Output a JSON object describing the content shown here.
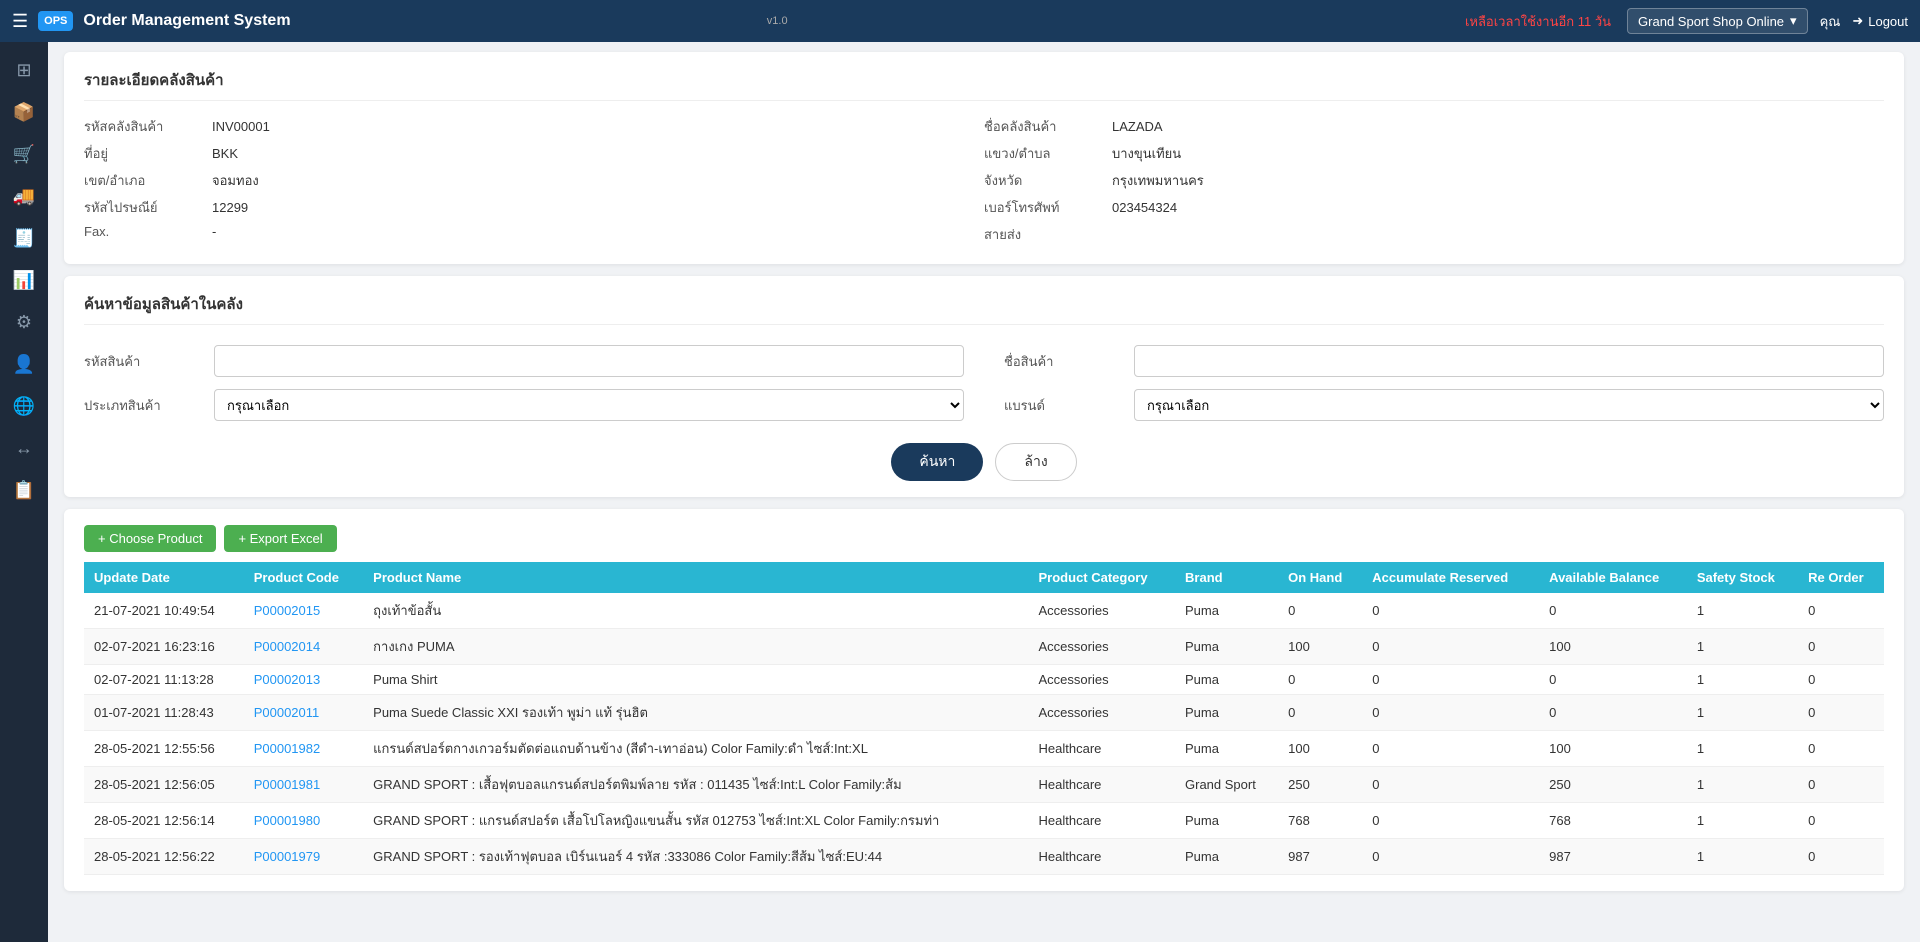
{
  "app": {
    "title": "Order Management System",
    "version": "v1.0",
    "warning": "เหลือเวลาใช้งานอีก 11 วัน",
    "shop_name": "Grand Sport Shop Online",
    "user": "คุณ",
    "logout_label": "Logout"
  },
  "sidebar": {
    "icons": [
      {
        "name": "dashboard-icon",
        "symbol": "⊞"
      },
      {
        "name": "box-icon",
        "symbol": "📦"
      },
      {
        "name": "cart-icon",
        "symbol": "🛒"
      },
      {
        "name": "truck-icon",
        "symbol": "🚚"
      },
      {
        "name": "receipt-icon",
        "symbol": "🧾"
      },
      {
        "name": "chart-icon",
        "symbol": "📊"
      },
      {
        "name": "settings-icon",
        "symbol": "⚙"
      },
      {
        "name": "user-icon",
        "symbol": "👤"
      },
      {
        "name": "globe-icon",
        "symbol": "🌐"
      },
      {
        "name": "transfer-icon",
        "symbol": "↔"
      },
      {
        "name": "report-icon",
        "symbol": "📋"
      }
    ]
  },
  "warehouse_detail": {
    "title": "รายละเอียดคลังสินค้า",
    "fields": {
      "warehouse_code_label": "รหัสคลังสินค้า",
      "warehouse_code_value": "INV00001",
      "warehouse_name_label": "ชื่อคลังสินค้า",
      "warehouse_name_value": "LAZADA",
      "address_label": "ที่อยู่",
      "address_value": "BKK",
      "subdistrict_label": "แขวง/ตำบล",
      "subdistrict_value": "บางขุนเทียน",
      "district_label": "เขต/อำเภอ",
      "district_value": "จอมทอง",
      "province_label": "จังหวัด",
      "province_value": "กรุงเทพมหานคร",
      "zipcode_label": "รหัสไปรษณีย์",
      "zipcode_value": "12299",
      "phone_label": "เบอร์โทรศัพท์",
      "phone_value": "023454324",
      "fax_label": "Fax.",
      "fax_value": "-",
      "shipping_label": "สายส่ง",
      "shipping_value": ""
    }
  },
  "search_section": {
    "title": "ค้นหาข้อมูลสินค้าในคลัง",
    "product_code_label": "รหัสสินค้า",
    "product_code_placeholder": "",
    "product_name_label": "ชื่อสินค้า",
    "product_name_placeholder": "",
    "category_label": "ประเภทสินค้า",
    "category_default": "กรุณาเลือก",
    "brand_label": "แบรนด์",
    "brand_default": "กรุณาเลือก",
    "search_button": "ค้นหา",
    "clear_button": "ล้าง"
  },
  "product_table": {
    "choose_button": "+ Choose Product",
    "export_button": "+ Export Excel",
    "columns": [
      "Update Date",
      "Product Code",
      "Product Name",
      "Product Category",
      "Brand",
      "On Hand",
      "Accumulate Reserved",
      "Available Balance",
      "Safety Stock",
      "Re Order"
    ],
    "rows": [
      {
        "update_date": "21-07-2021 10:49:54",
        "product_code": "P00002015",
        "product_name": "ถุงเท้าข้อสั้น",
        "category": "Accessories",
        "brand": "Puma",
        "on_hand": "0",
        "accum_reserved": "0",
        "available": "0",
        "safety_stock": "1",
        "reorder": "0",
        "reorder_red": true
      },
      {
        "update_date": "02-07-2021 16:23:16",
        "product_code": "P00002014",
        "product_name": "กางเกง PUMA",
        "category": "Accessories",
        "brand": "Puma",
        "on_hand": "100",
        "accum_reserved": "0",
        "available": "100",
        "safety_stock": "1",
        "reorder": "0",
        "reorder_red": false
      },
      {
        "update_date": "02-07-2021 11:13:28",
        "product_code": "P00002013",
        "product_name": "Puma Shirt",
        "category": "Accessories",
        "brand": "Puma",
        "on_hand": "0",
        "accum_reserved": "0",
        "available": "0",
        "safety_stock": "1",
        "reorder": "0",
        "reorder_red": true
      },
      {
        "update_date": "01-07-2021 11:28:43",
        "product_code": "P00002011",
        "product_name": "Puma Suede Classic XXI รองเท้า พูม่า แท้ รุ่นฮิต",
        "category": "Accessories",
        "brand": "Puma",
        "on_hand": "0",
        "accum_reserved": "0",
        "available": "0",
        "safety_stock": "1",
        "reorder": "0",
        "reorder_red": true
      },
      {
        "update_date": "28-05-2021 12:55:56",
        "product_code": "P00001982",
        "product_name": "แกรนด์สปอร์ตกางเกวอร์มตัดต่อแถบด้านข้าง (สีดำ-เทาอ่อน) Color Family:ดำ ไซส์:Int:XL",
        "category": "Healthcare",
        "brand": "Puma",
        "on_hand": "100",
        "accum_reserved": "0",
        "available": "100",
        "safety_stock": "1",
        "reorder": "0",
        "reorder_red": false
      },
      {
        "update_date": "28-05-2021 12:56:05",
        "product_code": "P00001981",
        "product_name": "GRAND SPORT : เสื้อฟุตบอลแกรนด์สปอร์ตพิมพ์ลาย รหัส : 011435 ไซส์:Int:L Color Family:ส้ม",
        "category": "Healthcare",
        "brand": "Grand Sport",
        "on_hand": "250",
        "accum_reserved": "0",
        "available": "250",
        "safety_stock": "1",
        "reorder": "0",
        "reorder_red": false
      },
      {
        "update_date": "28-05-2021 12:56:14",
        "product_code": "P00001980",
        "product_name": "GRAND SPORT : แกรนด์สปอร์ต เสื้อโปโลหญิงแขนสั้น รหัส 012753 ไซส์:Int:XL Color Family:กรมท่า",
        "category": "Healthcare",
        "brand": "Puma",
        "on_hand": "768",
        "accum_reserved": "0",
        "available": "768",
        "safety_stock": "1",
        "reorder": "0",
        "reorder_red": false
      },
      {
        "update_date": "28-05-2021 12:56:22",
        "product_code": "P00001979",
        "product_name": "GRAND SPORT : รองเท้าฟุตบอล เบิร์นเนอร์ 4 รหัส :333086 Color Family:สีส้ม ไซส์:EU:44",
        "category": "Healthcare",
        "brand": "Puma",
        "on_hand": "987",
        "accum_reserved": "0",
        "available": "987",
        "safety_stock": "1",
        "reorder": "0",
        "reorder_red": false
      }
    ]
  }
}
